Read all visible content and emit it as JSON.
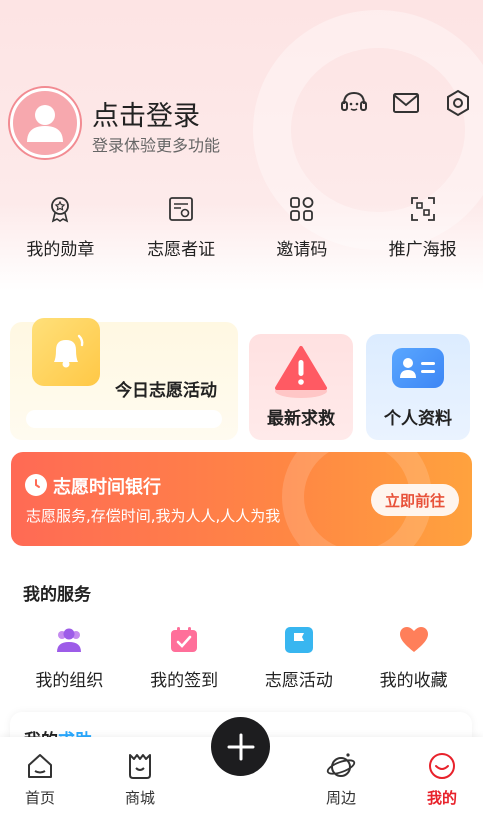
{
  "profile": {
    "login_title": "点击登录",
    "login_subtitle": "登录体验更多功能"
  },
  "header_icons": [
    "customer-service-icon",
    "mail-icon",
    "settings-icon"
  ],
  "quick_links": [
    {
      "label": "我的勋章",
      "icon": "medal-icon"
    },
    {
      "label": "志愿者证",
      "icon": "certificate-icon"
    },
    {
      "label": "邀请码",
      "icon": "invite-code-icon"
    },
    {
      "label": "推广海报",
      "icon": "poster-scan-icon"
    }
  ],
  "cards": {
    "activity": "今日志愿活动",
    "help": "最新求救",
    "info": "个人资料"
  },
  "time_bank": {
    "title": "志愿时间银行",
    "subtitle": "志愿服务,存偿时间,我为人人,人人为我",
    "button": "立即前往"
  },
  "services": {
    "title": "我的服务",
    "items": [
      {
        "label": "我的组织",
        "icon": "group-icon"
      },
      {
        "label": "我的签到",
        "icon": "checkin-icon"
      },
      {
        "label": "志愿活动",
        "icon": "flag-icon"
      },
      {
        "label": "我的收藏",
        "icon": "heart-icon"
      }
    ]
  },
  "help_section": {
    "title_prefix": "我的",
    "title_highlight": "求助"
  },
  "tabbar": {
    "items": [
      {
        "label": "首页",
        "icon": "home-icon",
        "active": false
      },
      {
        "label": "商城",
        "icon": "shop-icon",
        "active": false
      },
      {
        "label": "周边",
        "icon": "planet-icon",
        "active": false
      },
      {
        "label": "我的",
        "icon": "smile-icon",
        "active": true
      }
    ]
  },
  "colors": {
    "accent_red": "#e8222b",
    "bank_gradient_start": "#ff6a55",
    "bank_gradient_end": "#ffa23e",
    "highlight_blue": "#29a9ff"
  }
}
